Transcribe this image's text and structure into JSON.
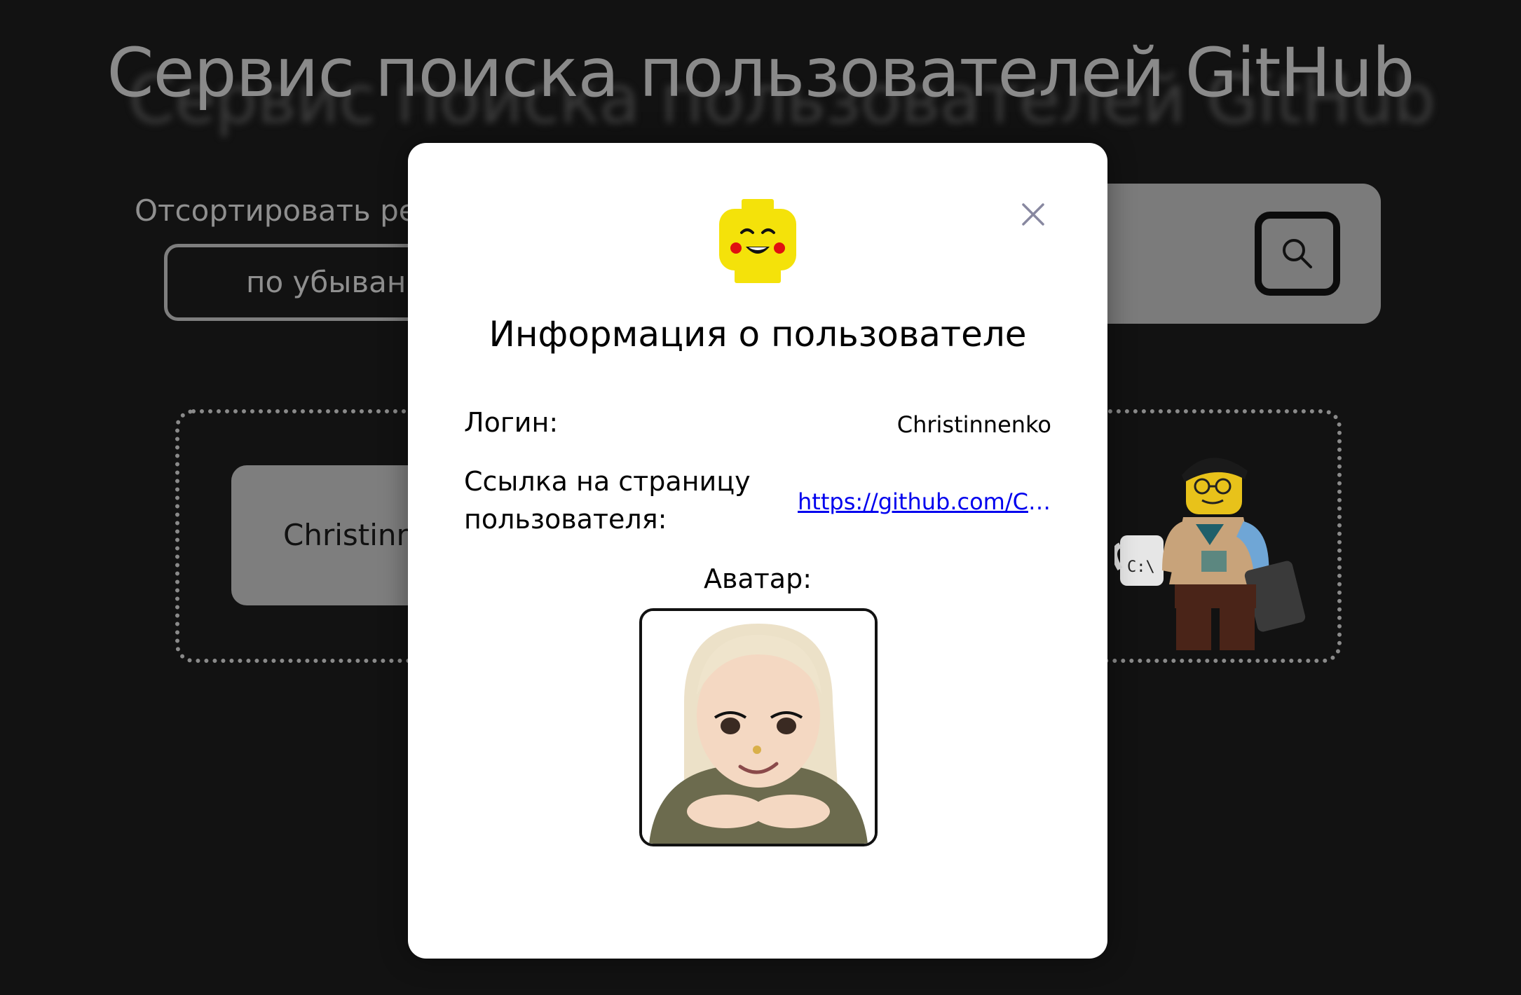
{
  "page": {
    "title": "Сервис поиска пользователей GitHub",
    "sort_label": "Отсортировать реп",
    "sort_value": "по убывани"
  },
  "search": {
    "button_icon": "search-icon"
  },
  "results": [
    {
      "name": "Christinne"
    }
  ],
  "modal": {
    "title": "Информация о пользователе",
    "login_label": "Логин:",
    "login_value": "Christinnenko",
    "link_label": "Ссылка на страницу пользователя:",
    "link_value": "https://github.com/Chri…",
    "avatar_label": "Аватар:",
    "close_icon": "close-icon",
    "logo_icon": "lego-head-icon"
  },
  "colors": {
    "background": "#121212",
    "modal": "#ffffff",
    "link": "#0000ee",
    "muted": "#8a8a8a"
  }
}
